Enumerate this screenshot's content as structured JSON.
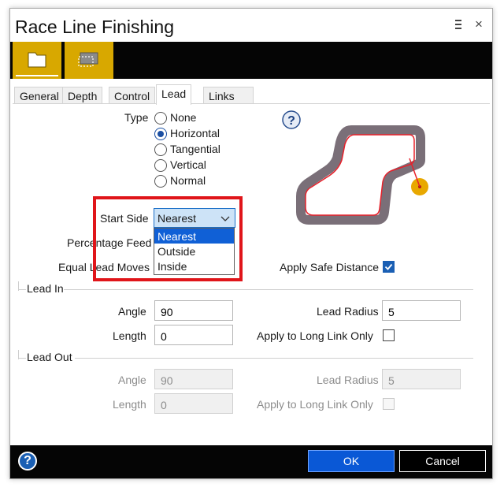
{
  "window": {
    "title": "Race Line Finishing",
    "menu_icon": "menu-icon",
    "close_icon": "close-icon",
    "close_glyph": "×"
  },
  "toolbar": {
    "buttons": [
      {
        "icon": "folder-icon"
      },
      {
        "icon": "selection-icon"
      }
    ],
    "accent": "#d8a800"
  },
  "tabs": [
    {
      "label": "General"
    },
    {
      "label": "Depth"
    },
    {
      "label": "Control"
    },
    {
      "label": "Lead",
      "active": true
    },
    {
      "label": "Links"
    }
  ],
  "lead": {
    "type_label": "Type",
    "type_options": [
      {
        "label": "None",
        "checked": false
      },
      {
        "label": "Horizontal",
        "checked": true
      },
      {
        "label": "Tangential",
        "checked": false
      },
      {
        "label": "Vertical",
        "checked": false
      },
      {
        "label": "Normal",
        "checked": false
      }
    ],
    "start_side_label": "Start Side",
    "start_side_value": "Nearest",
    "start_side_options": [
      {
        "label": "Nearest",
        "selected": true
      },
      {
        "label": "Outside",
        "selected": false
      },
      {
        "label": "Inside",
        "selected": false
      }
    ],
    "percentage_feed_label": "Percentage Feed",
    "equal_lead_moves_label": "Equal Lead Moves",
    "apply_safe_distance_label": "Apply Safe Distance",
    "apply_safe_distance_checked": true
  },
  "lead_in": {
    "header": "Lead In",
    "angle_label": "Angle",
    "angle_value": "90",
    "length_label": "Length",
    "length_value": "0",
    "lead_radius_label": "Lead Radius",
    "lead_radius_value": "5",
    "apply_long_link_label": "Apply to Long Link Only",
    "apply_long_link_checked": false
  },
  "lead_out": {
    "header": "Lead Out",
    "angle_label": "Angle",
    "angle_value": "90",
    "length_label": "Length",
    "length_value": "0",
    "lead_radius_label": "Lead Radius",
    "lead_radius_value": "5",
    "apply_long_link_label": "Apply to Long Link Only",
    "apply_long_link_checked": false
  },
  "footer": {
    "help_glyph": "?",
    "ok_label": "OK",
    "cancel_label": "Cancel"
  },
  "colors": {
    "ok_blue": "#0a58d6",
    "highlight_red": "#e0151a",
    "select_bg": "#cde3f7",
    "path_gray": "#7a6f78",
    "path_red": "#e8202a",
    "start_point": "#e8a800"
  }
}
